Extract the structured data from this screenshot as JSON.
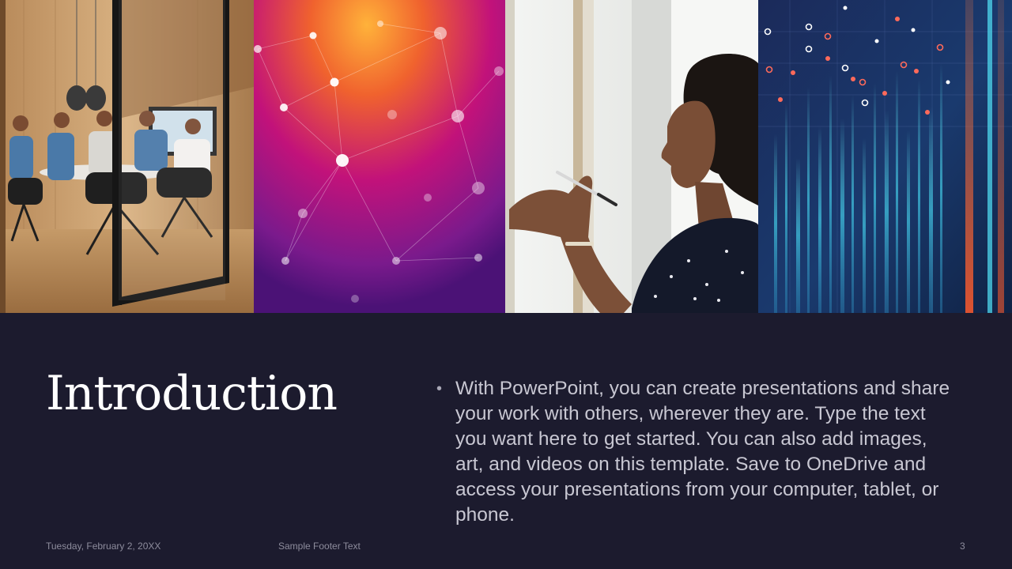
{
  "slide": {
    "title": "Introduction",
    "body": "With PowerPoint, you can create presentations and share your work with others, wherever they are. Type the text you want here to get started. You can also add images, art, and videos on this template. Save to OneDrive and access your presentations from your computer, tablet, or phone.",
    "bullet": "•"
  },
  "footer": {
    "date": "Tuesday, February 2, 20XX",
    "text": "Sample Footer Text",
    "slide_number": "3"
  },
  "images": [
    {
      "name": "meeting-room-photo"
    },
    {
      "name": "network-graphic-photo"
    },
    {
      "name": "woman-writing-photo"
    },
    {
      "name": "data-visualization-photo"
    }
  ],
  "colors": {
    "background": "#1c1b2e",
    "title": "#ffffff",
    "body": "#c8c7d2",
    "footer": "#8d8c9c"
  }
}
